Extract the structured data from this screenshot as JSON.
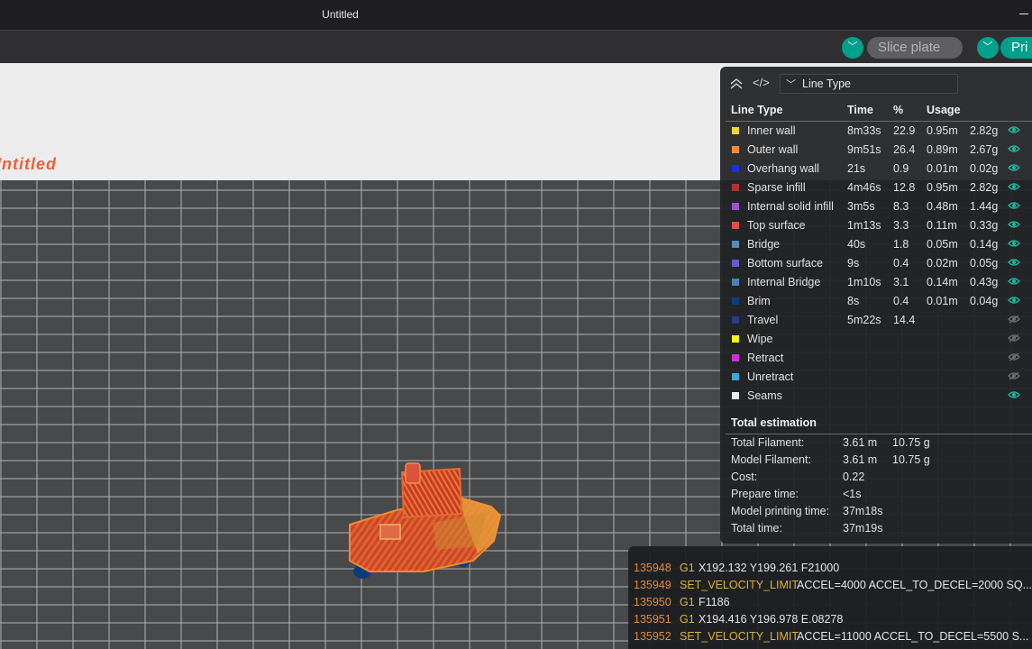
{
  "window": {
    "title": "Untitled"
  },
  "toolbar": {
    "slice_label": "Slice plate",
    "print_label": "Pri",
    "arrow_glyph": "﹀"
  },
  "plate": {
    "name": "Untitled"
  },
  "legend": {
    "view_type": "Line Type",
    "headers": {
      "type": "Line Type",
      "time": "Time",
      "percent": "%",
      "usage": "Usage"
    },
    "rows": [
      {
        "name": "Inner wall",
        "color": "#f2d23e",
        "time": "8m33s",
        "percent": "22.9",
        "length": "0.95m",
        "weight": "2.82g",
        "visible": true
      },
      {
        "name": "Outer wall",
        "color": "#f28a33",
        "time": "9m51s",
        "percent": "26.4",
        "length": "0.89m",
        "weight": "2.67g",
        "visible": true
      },
      {
        "name": "Overhang wall",
        "color": "#1f2ce8",
        "time": "21s",
        "percent": "0.9",
        "length": "0.01m",
        "weight": "0.02g",
        "visible": true
      },
      {
        "name": "Sparse infill",
        "color": "#b23232",
        "time": "4m46s",
        "percent": "12.8",
        "length": "0.95m",
        "weight": "2.82g",
        "visible": true
      },
      {
        "name": "Internal solid infill",
        "color": "#9b53c8",
        "time": "3m5s",
        "percent": "8.3",
        "length": "0.48m",
        "weight": "1.44g",
        "visible": true
      },
      {
        "name": "Top surface",
        "color": "#e64a4a",
        "time": "1m13s",
        "percent": "3.3",
        "length": "0.11m",
        "weight": "0.33g",
        "visible": true
      },
      {
        "name": "Bridge",
        "color": "#5b86bf",
        "time": "40s",
        "percent": "1.8",
        "length": "0.05m",
        "weight": "0.14g",
        "visible": true
      },
      {
        "name": "Bottom surface",
        "color": "#6a5acd",
        "time": "9s",
        "percent": "0.4",
        "length": "0.02m",
        "weight": "0.05g",
        "visible": true
      },
      {
        "name": "Internal Bridge",
        "color": "#4e7fb8",
        "time": "1m10s",
        "percent": "3.1",
        "length": "0.14m",
        "weight": "0.43g",
        "visible": true
      },
      {
        "name": "Brim",
        "color": "#0f3d7a",
        "time": "8s",
        "percent": "0.4",
        "length": "0.01m",
        "weight": "0.04g",
        "visible": true
      },
      {
        "name": "Travel",
        "color": "#2b3a8c",
        "time": "5m22s",
        "percent": "14.4",
        "length": "",
        "weight": "",
        "visible": false
      },
      {
        "name": "Wipe",
        "color": "#f5f51a",
        "time": "",
        "percent": "",
        "length": "",
        "weight": "",
        "visible": false
      },
      {
        "name": "Retract",
        "color": "#cc33cc",
        "time": "",
        "percent": "",
        "length": "",
        "weight": "",
        "visible": false
      },
      {
        "name": "Unretract",
        "color": "#3fa8d8",
        "time": "",
        "percent": "",
        "length": "",
        "weight": "",
        "visible": false
      },
      {
        "name": "Seams",
        "color": "#ececec",
        "time": "",
        "percent": "",
        "length": "",
        "weight": "",
        "visible": true
      }
    ],
    "estimation": {
      "title": "Total estimation",
      "rows": [
        {
          "label": "Total Filament:",
          "v1": "3.61 m",
          "v2": "10.75 g"
        },
        {
          "label": "Model Filament:",
          "v1": "3.61 m",
          "v2": "10.75 g"
        },
        {
          "label": "Cost:",
          "v1": "0.22",
          "v2": ""
        },
        {
          "label": "Prepare time:",
          "v1": "<1s",
          "v2": ""
        },
        {
          "label": "Model printing time:",
          "v1": "37m18s",
          "v2": ""
        },
        {
          "label": "Total time:",
          "v1": "37m19s",
          "v2": ""
        }
      ]
    }
  },
  "gcode": {
    "lines": [
      {
        "num": "135948",
        "cmd": "G1",
        "args": "X192.132 Y199.261 F21000"
      },
      {
        "num": "135949",
        "cmd": "SET_VELOCITY_LIMIT",
        "args": "ACCEL=4000 ACCEL_TO_DECEL=2000 SQ..."
      },
      {
        "num": "135950",
        "cmd": "G1",
        "args": "F1186"
      },
      {
        "num": "135951",
        "cmd": "G1",
        "args": "X194.416 Y196.978 E.08278"
      },
      {
        "num": "135952",
        "cmd": "SET_VELOCITY_LIMIT",
        "args": "ACCEL=11000 ACCEL_TO_DECEL=5500 S..."
      }
    ]
  },
  "colors": {
    "accent": "#00a08a",
    "eye_on": "#1db9a0",
    "eye_off": "#6d6e72"
  }
}
